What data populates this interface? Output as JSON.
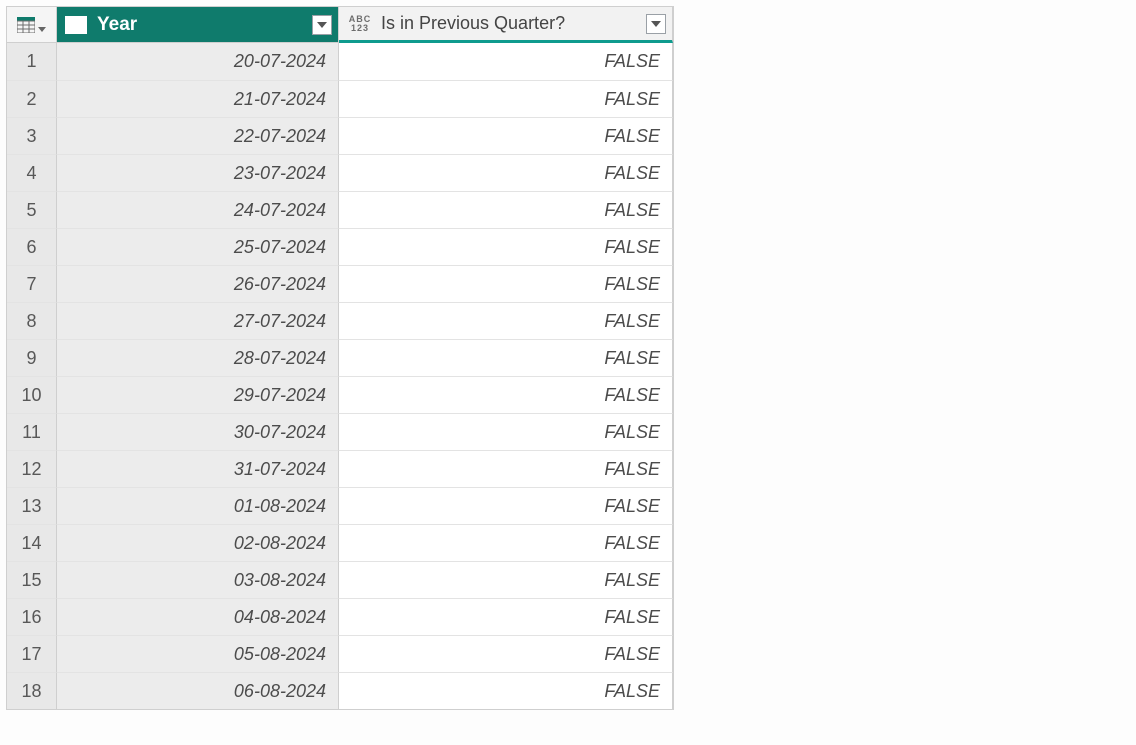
{
  "columns": {
    "year": {
      "label": "Year",
      "type": "date"
    },
    "prev": {
      "label": "Is in Previous Quarter?",
      "type": "any"
    }
  },
  "rows": [
    {
      "n": "1",
      "year": "20-07-2024",
      "prev": "FALSE"
    },
    {
      "n": "2",
      "year": "21-07-2024",
      "prev": "FALSE"
    },
    {
      "n": "3",
      "year": "22-07-2024",
      "prev": "FALSE"
    },
    {
      "n": "4",
      "year": "23-07-2024",
      "prev": "FALSE"
    },
    {
      "n": "5",
      "year": "24-07-2024",
      "prev": "FALSE"
    },
    {
      "n": "6",
      "year": "25-07-2024",
      "prev": "FALSE"
    },
    {
      "n": "7",
      "year": "26-07-2024",
      "prev": "FALSE"
    },
    {
      "n": "8",
      "year": "27-07-2024",
      "prev": "FALSE"
    },
    {
      "n": "9",
      "year": "28-07-2024",
      "prev": "FALSE"
    },
    {
      "n": "10",
      "year": "29-07-2024",
      "prev": "FALSE"
    },
    {
      "n": "11",
      "year": "30-07-2024",
      "prev": "FALSE"
    },
    {
      "n": "12",
      "year": "31-07-2024",
      "prev": "FALSE"
    },
    {
      "n": "13",
      "year": "01-08-2024",
      "prev": "FALSE"
    },
    {
      "n": "14",
      "year": "02-08-2024",
      "prev": "FALSE"
    },
    {
      "n": "15",
      "year": "03-08-2024",
      "prev": "FALSE"
    },
    {
      "n": "16",
      "year": "04-08-2024",
      "prev": "FALSE"
    },
    {
      "n": "17",
      "year": "05-08-2024",
      "prev": "FALSE"
    },
    {
      "n": "18",
      "year": "06-08-2024",
      "prev": "FALSE"
    }
  ]
}
